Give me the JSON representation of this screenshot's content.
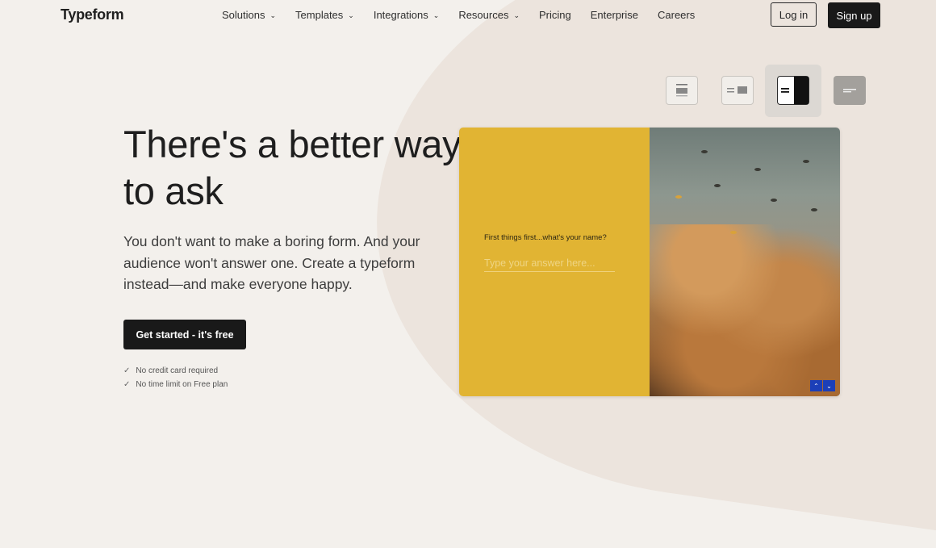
{
  "header": {
    "logo": "Typeform",
    "nav": [
      {
        "label": "Solutions",
        "dropdown": true
      },
      {
        "label": "Templates",
        "dropdown": true
      },
      {
        "label": "Integrations",
        "dropdown": true
      },
      {
        "label": "Resources",
        "dropdown": true
      },
      {
        "label": "Pricing",
        "dropdown": false
      },
      {
        "label": "Enterprise",
        "dropdown": false
      },
      {
        "label": "Careers",
        "dropdown": false
      }
    ],
    "login_label": "Log in",
    "signup_label": "Sign up"
  },
  "hero": {
    "title": "There's a better way to ask",
    "subtitle": "You don't want to make a boring form. And your audience won't answer one. Create a typeform instead—and make everyone happy.",
    "cta_label": "Get started - it's free",
    "checks": [
      "No credit card required",
      "No time limit on Free plan"
    ],
    "check_icon": "✓"
  },
  "layout_options": {
    "icons": [
      "layout-stack-icon",
      "layout-split-left-icon",
      "layout-split-right-icon",
      "layout-wallpaper-icon"
    ],
    "selected_index": 2
  },
  "form_preview": {
    "question": "First things first...what's your name?",
    "placeholder": "Type your answer here...",
    "up_arrow": "⌃",
    "down_arrow": "⌄",
    "accent_color": "#e1b433",
    "nav_color": "#1c3fb8"
  }
}
